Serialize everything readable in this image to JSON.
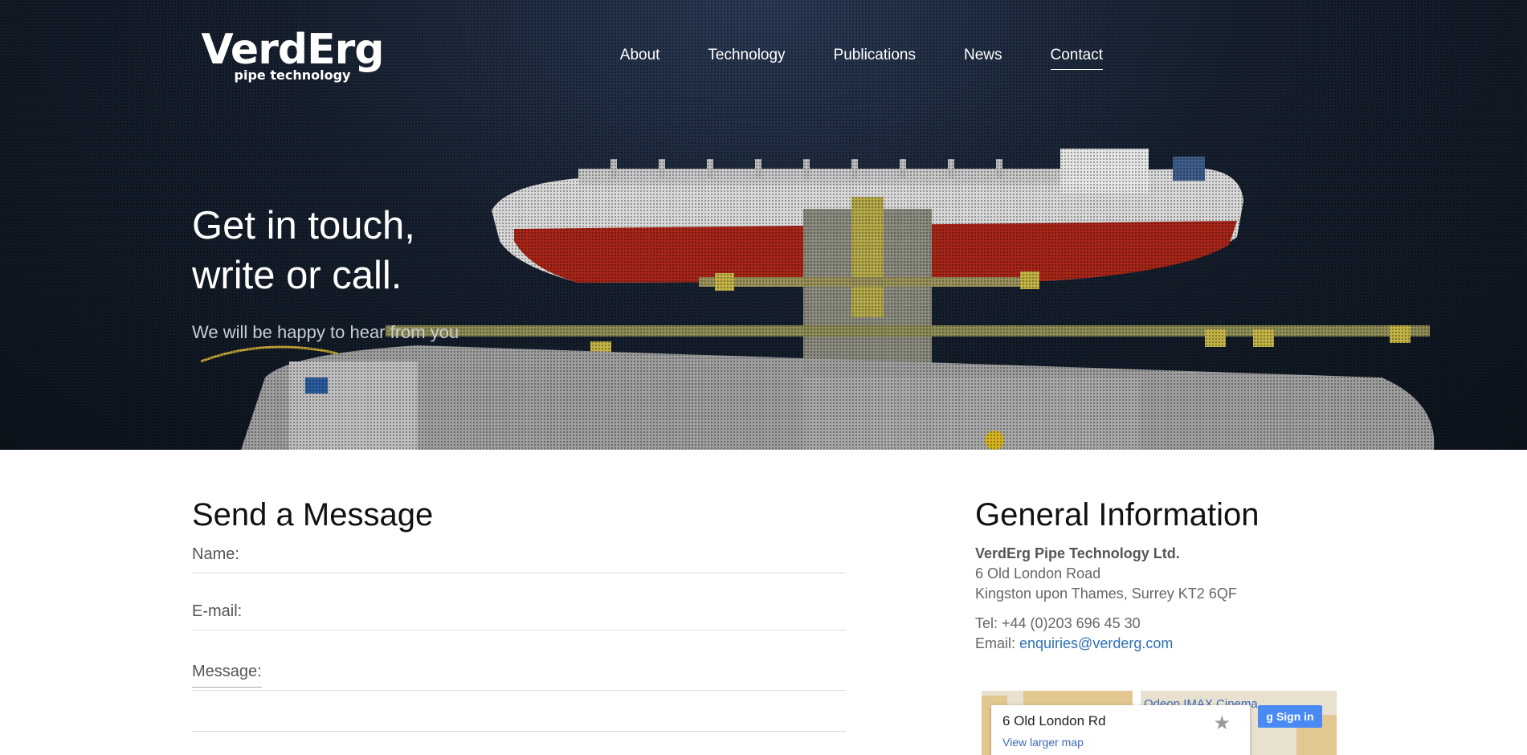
{
  "brand": {
    "name": "VerdErg",
    "tagline": "pipe technology"
  },
  "nav": {
    "items": [
      {
        "label": "About"
      },
      {
        "label": "Technology"
      },
      {
        "label": "Publications"
      },
      {
        "label": "News"
      },
      {
        "label": "Contact"
      }
    ],
    "active": "Contact"
  },
  "hero": {
    "title_line1": "Get in touch,",
    "title_line2": "write or call.",
    "subtitle": "We will be happy to hear from you"
  },
  "form": {
    "title": "Send a Message",
    "name_label": "Name:",
    "email_label": "E-mail:",
    "message_label": "Message:"
  },
  "info": {
    "title": "General Information",
    "company": "VerdErg Pipe Technology Ltd.",
    "address1": "6 Old London Road",
    "address2": "Kingston upon Thames, Surrey KT2 6QF",
    "tel": "Tel: +44 (0)203 696 45 30",
    "email_prefix": "Email: ",
    "email": "enquiries@verderg.com"
  },
  "map": {
    "place": "6 Old London Rd",
    "view_larger": "View larger map",
    "poi": "Odeon IMAX Cinema",
    "signin": "Sign in",
    "signin_icon": "g"
  },
  "colors": {
    "link": "#2d6fb5",
    "hero_bg": "#16202f",
    "hull_red": "#a52518"
  }
}
